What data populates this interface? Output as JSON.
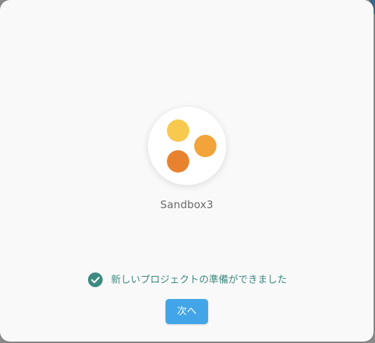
{
  "project": {
    "name": "Sandbox3",
    "logo_colors": [
      "#f7c94f",
      "#f2a43a",
      "#e8822f"
    ]
  },
  "status": {
    "icon": "check-circle-icon",
    "text": "新しいプロジェクトの準備ができました",
    "color": "#3d8a80"
  },
  "actions": {
    "next_label": "次へ",
    "accent": "#42a5e8"
  }
}
